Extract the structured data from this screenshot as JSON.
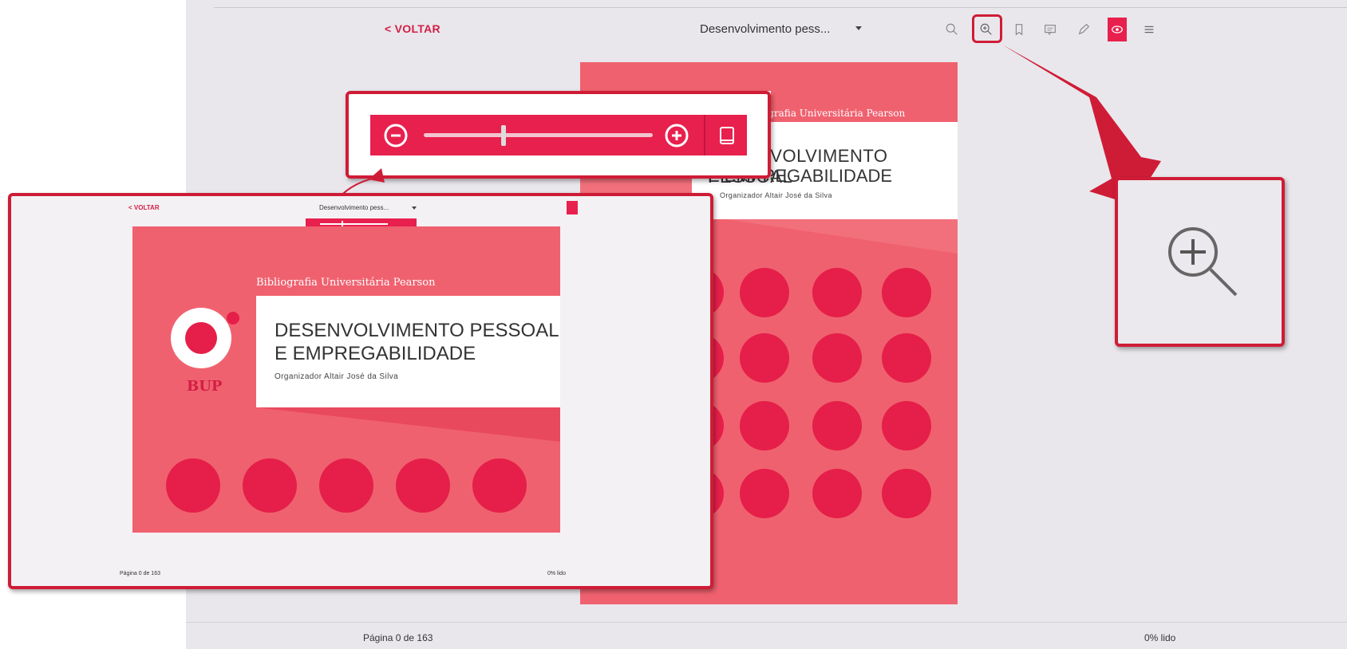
{
  "header": {
    "back_label": "< VOLTAR",
    "doc_title": "Desenvolvimento pess...",
    "toolbar_icons": [
      "search-icon",
      "zoom-in-icon",
      "bookmark-icon",
      "comment-icon",
      "pencil-icon",
      "eye-icon",
      "menu-icon"
    ]
  },
  "book": {
    "publisher": "Bibliografia Universitária Pearson",
    "title_line1": "DESENVOLVIMENTO PESSOAL",
    "title_line2": "E EMPREGABILIDADE",
    "organizer": "Organizador Altair José da Silva",
    "logo_text": "BUP"
  },
  "footer": {
    "page_label": "Página 0 de 163",
    "read_label": "0% lido"
  },
  "inset": {
    "back_label": "< VOLTAR",
    "doc_title": "Desenvolvimento pess...",
    "page_label": "Página 0 de 163",
    "read_label": "0% lido"
  },
  "zoom": {
    "level_fraction": 0.35
  },
  "colors": {
    "accent": "#e8204d",
    "highlight": "#cf1c36",
    "cover": "#f0616f"
  }
}
